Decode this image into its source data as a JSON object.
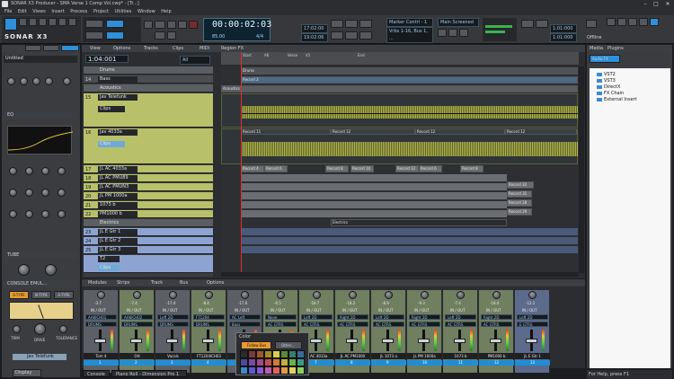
{
  "window": {
    "title": "SONAR X3 Producer - SMA Verse 1 Comp Vol.cwp* - [Tr...]",
    "minimize": "–",
    "maximize": "□",
    "close": "✕"
  },
  "menu": [
    "File",
    "Edit",
    "Views",
    "Insert",
    "Process",
    "Project",
    "Utilities",
    "Window",
    "Help"
  ],
  "control_bar": {
    "logo": "SONAR X3",
    "time": "00:00:02:03",
    "tempo": "85.00",
    "meter": "4/4",
    "loop_start": "17:02:00",
    "loop_end": "19:02:06",
    "snap": "Marker Contrl - 1",
    "mix_mode": "Main Screened",
    "punch_in": "1:01:000",
    "punch_out": "1:01:000",
    "offline": "Offline",
    "track_name": "Vrbs 1-16, Bus 1, ..."
  },
  "inspector": {
    "track_title": "Untitled",
    "eq_label": "EQ",
    "tube_label": "TUBE",
    "console_label": "CONSOLE EMUL...",
    "console_types": [
      "S-TYPE",
      "N-TYPE",
      "A-TYPE"
    ],
    "knob_labels": [
      "TRIM",
      "DRIVE",
      "TOLERANCE"
    ],
    "channel_name": "Jav Telefunk",
    "display_btn": "Display"
  },
  "track_view": {
    "menu": [
      "View",
      "Options",
      "Tracks",
      "Clips",
      "MIDI",
      "Region FX"
    ],
    "position": "1:04:001",
    "filter": "All",
    "markers": [
      "Start",
      "A6",
      "Verse",
      "V1",
      "End"
    ],
    "tracks": [
      {
        "num": "",
        "name": "Drums",
        "type": "folder"
      },
      {
        "num": "14",
        "name": "Bass",
        "type": "track"
      },
      {
        "num": "",
        "name": "Acoustics",
        "type": "folder"
      },
      {
        "num": "15",
        "name": "Jav Telefunk",
        "type": "track"
      },
      {
        "num": "",
        "name": "Clips",
        "type": "lane"
      },
      {
        "num": "16",
        "name": "Jav 4033a",
        "type": "track"
      },
      {
        "num": "",
        "name": "Clips",
        "type": "lane"
      },
      {
        "num": "17",
        "name": "JL AC 4033a",
        "type": "track"
      },
      {
        "num": "18",
        "name": "JL AC PMU89",
        "type": "track"
      },
      {
        "num": "19",
        "name": "JL AC PMUN3",
        "type": "track"
      },
      {
        "num": "20",
        "name": "JL PM 1000a",
        "type": "track"
      },
      {
        "num": "21",
        "name": "1073 b",
        "type": "track"
      },
      {
        "num": "22",
        "name": "PM1000 b",
        "type": "track"
      },
      {
        "num": "",
        "name": "Electrics",
        "type": "folder"
      },
      {
        "num": "23",
        "name": "JL E Gtr 1",
        "type": "track"
      },
      {
        "num": "24",
        "name": "JL E Gtr 2",
        "type": "track"
      },
      {
        "num": "25",
        "name": "JL E Gtr 3",
        "type": "track"
      },
      {
        "num": "",
        "name": "T2",
        "type": "lane"
      },
      {
        "num": "",
        "name": "Clips",
        "type": "lane"
      }
    ],
    "clips": [
      "Drums",
      "Record 2",
      "Acoustics",
      "Record 11",
      "Record 12",
      "Record 12",
      "Record 12",
      "Record 4",
      "Record 6",
      "Record 8",
      "Record 10",
      "Record 12",
      "Record 6",
      "Record 8",
      "Record 32",
      "Record 31",
      "Record 28",
      "Record 29",
      "Electrics"
    ]
  },
  "console": {
    "menu": [
      "Modules",
      "Strips",
      "Track",
      "Bus",
      "Options"
    ],
    "channels": [
      {
        "name": "Tom 4",
        "num": "1",
        "val": "-3.7",
        "io": "IN / OUT",
        "input": "AAKICH01",
        "output": "DRUMS",
        "color": "gray"
      },
      {
        "name": "OH",
        "num": "2",
        "val": "-7.4",
        "io": "IN / OUT",
        "input": "AAKICH02",
        "output": "DRUMS",
        "color": "green"
      },
      {
        "name": "Vocals",
        "num": "3",
        "val": "-17.4",
        "io": "IN / OUT",
        "input": "Left 2D",
        "output": "DRUMS",
        "color": "gray"
      },
      {
        "name": "FT1204ICH03",
        "num": "4",
        "val": "-8.4",
        "io": "IN / OUT",
        "input": "FT1204",
        "output": "DRUMS",
        "color": "green"
      },
      {
        "name": "Bass",
        "num": "5",
        "val": "-17.6",
        "io": "IN / OUT",
        "input": "AC Left",
        "output": "Bass",
        "color": "gray"
      },
      {
        "name": "None",
        "num": "6",
        "val": "-6.5",
        "io": "IN / OUT",
        "input": "None",
        "output": "AC GTRS",
        "color": "green"
      },
      {
        "name": "JL AC 4033a",
        "num": "7",
        "val": "-18.7",
        "io": "IN / OUT",
        "input": "Left 2D",
        "output": "AC GTRS",
        "color": "green"
      },
      {
        "name": "JL AC PM1000",
        "num": "8",
        "val": "-18.2",
        "io": "IN / OUT",
        "input": "Right 2D",
        "output": "AC GTRS",
        "color": "green"
      },
      {
        "name": "JL 1073 a",
        "num": "9",
        "val": "-8.9",
        "io": "IN / OUT",
        "input": "Left 2D",
        "output": "AC GTRS",
        "color": "green"
      },
      {
        "name": "JL PM 1000a",
        "num": "10",
        "val": "-9.3",
        "io": "IN / OUT",
        "input": "Right 2D",
        "output": "AC GTRS",
        "color": "green"
      },
      {
        "name": "1073 b",
        "num": "11",
        "val": "-7.4",
        "io": "IN / OUT",
        "input": "Left 2D",
        "output": "AC GTRS",
        "color": "green"
      },
      {
        "name": "PM1000 b",
        "num": "12",
        "val": "-18.4",
        "io": "IN / OUT",
        "input": "Right 2D",
        "output": "AC GTRS",
        "color": "green"
      },
      {
        "name": "JL E Gtr 1",
        "num": "13",
        "val": "-12.1",
        "io": "IN / OUT",
        "input": "Left 2D",
        "output": "E GTRS",
        "color": "blue"
      }
    ],
    "color_popup": {
      "title": "Color",
      "follow_bus": "Follow Bus",
      "other": "Other...",
      "swatches": [
        "#2b2b2b",
        "#7a3a3a",
        "#9a5a2a",
        "#a08a2a",
        "#d8d04a",
        "#5a8a3a",
        "#3a7a6a",
        "#3a6a9a",
        "#4a4aa0",
        "#7a4aa0",
        "#a04a8a",
        "#c05050",
        "#d07a3a",
        "#c0b040",
        "#6ab04a",
        "#3a9a8a",
        "#3a8ac0",
        "#5a5ad0",
        "#8a5ad0",
        "#c05ab0",
        "#e06060",
        "#e09a4a",
        "#e0d060",
        "#8ad060"
      ]
    }
  },
  "browser": {
    "tabs": [
      "Media",
      "Plugins"
    ],
    "active_button": "Audio FX",
    "tree": [
      "VST2",
      "VST3",
      "DirectX",
      "FX Chain",
      "External Insert"
    ]
  },
  "bottom_tabs": [
    "Console",
    "Piano Roll - Dimension Pro 1"
  ],
  "status": "For Help, press F1"
}
